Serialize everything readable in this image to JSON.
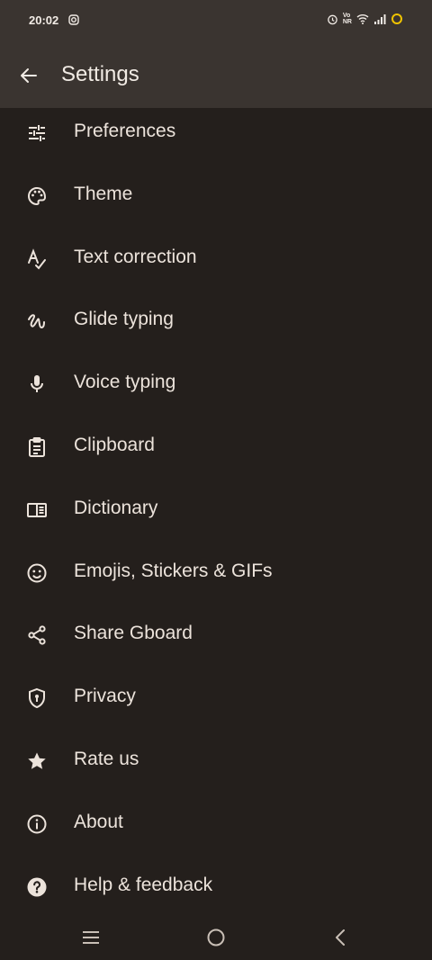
{
  "status_bar": {
    "time": "20:02",
    "icons": [
      "instagram-icon",
      "alarm-icon",
      "volte-icon",
      "wifi-icon",
      "signal-icon",
      "battery-saver-icon"
    ],
    "accent": "#f0c400"
  },
  "app_bar": {
    "title": "Settings",
    "back_icon": "arrow-back-icon"
  },
  "menu": {
    "items": [
      {
        "label": "Preferences",
        "icon": "tune-icon"
      },
      {
        "label": "Theme",
        "icon": "palette-icon"
      },
      {
        "label": "Text correction",
        "icon": "spellcheck-icon"
      },
      {
        "label": "Glide typing",
        "icon": "gesture-icon"
      },
      {
        "label": "Voice typing",
        "icon": "microphone-icon"
      },
      {
        "label": "Clipboard",
        "icon": "clipboard-icon"
      },
      {
        "label": "Dictionary",
        "icon": "dictionary-icon"
      },
      {
        "label": "Emojis, Stickers & GIFs",
        "icon": "emoji-icon"
      },
      {
        "label": "Share Gboard",
        "icon": "share-icon"
      },
      {
        "label": "Privacy",
        "icon": "shield-icon"
      },
      {
        "label": "Rate us",
        "icon": "star-icon"
      },
      {
        "label": "About",
        "icon": "info-icon"
      },
      {
        "label": "Help & feedback",
        "icon": "help-icon"
      }
    ]
  },
  "nav_bar": {
    "buttons": [
      "menu-icon",
      "home-icon",
      "back-icon"
    ]
  },
  "colors": {
    "background": "#241f1c",
    "app_bar": "#3a3430",
    "text": "#ece3db"
  }
}
